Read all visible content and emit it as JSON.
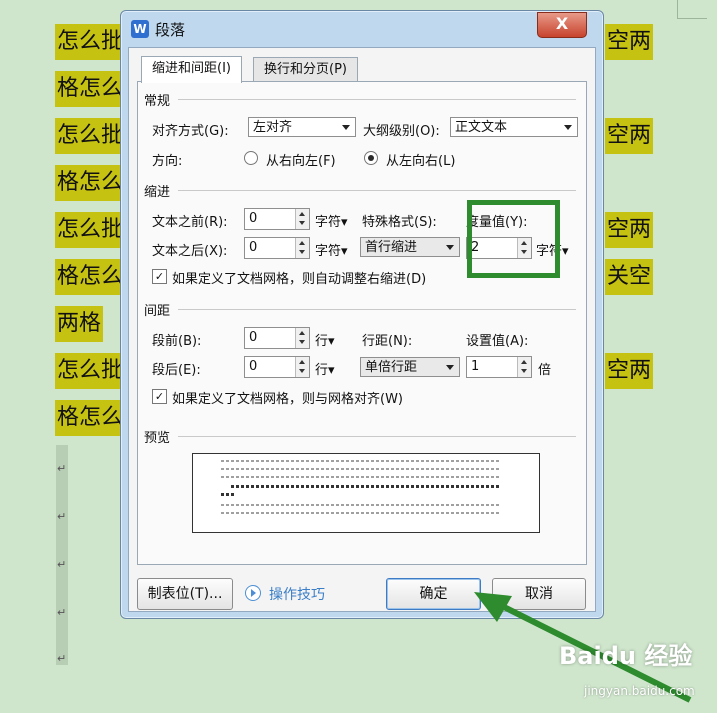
{
  "document": {
    "lines_left": [
      "怎么批",
      "格怎么",
      "怎么批",
      "格怎么",
      "怎么批",
      "格怎么",
      "两格",
      "怎么批",
      "格怎么"
    ],
    "lines_right": [
      "空两",
      "空两",
      "空两",
      "关空",
      "空两"
    ]
  },
  "dialog": {
    "title": "段落",
    "app_icon": "W",
    "close_label": "X",
    "tabs": [
      "缩进和间距(I)",
      "换行和分页(P)"
    ],
    "general": {
      "title": "常规",
      "alignment_label": "对齐方式(G):",
      "alignment_value": "左对齐",
      "outline_label": "大纲级别(O):",
      "outline_value": "正文文本",
      "direction_label": "方向:",
      "rtl_label": "从右向左(F)",
      "ltr_label": "从左向右(L)",
      "direction_selected": "从左向右(L)"
    },
    "indent": {
      "title": "缩进",
      "before_label": "文本之前(R):",
      "before_value": "0",
      "before_unit": "字符",
      "after_label": "文本之后(X):",
      "after_value": "0",
      "after_unit": "字符",
      "special_label": "特殊格式(S):",
      "special_value": "首行缩进",
      "measure_label": "度量值(Y):",
      "measure_value": "2",
      "measure_unit": "字符",
      "auto_adjust_label": "如果定义了文档网格，则自动调整右缩进(D)",
      "auto_adjust_checked": true
    },
    "spacing": {
      "title": "间距",
      "before_label": "段前(B):",
      "before_value": "0",
      "before_unit": "行",
      "after_label": "段后(E):",
      "after_value": "0",
      "after_unit": "行",
      "line_label": "行距(N):",
      "line_value": "单倍行距",
      "setting_label": "设置值(A):",
      "setting_value": "1",
      "setting_unit": "倍",
      "grid_label": "如果定义了文档网格，则与网格对齐(W)",
      "grid_checked": true
    },
    "preview": {
      "title": "预览"
    },
    "buttons": {
      "tabs_label": "制表位(T)...",
      "tips_label": "操作技巧",
      "ok_label": "确定",
      "cancel_label": "取消"
    }
  },
  "watermark": {
    "brand": "Baidu 经验",
    "url": "jingyan.baidu.com"
  },
  "colors": {
    "highlight_border": "#2e8b2e",
    "arrow": "#2e8b2e",
    "document_highlight": "#c6c212",
    "background": "#cfe6cc"
  }
}
